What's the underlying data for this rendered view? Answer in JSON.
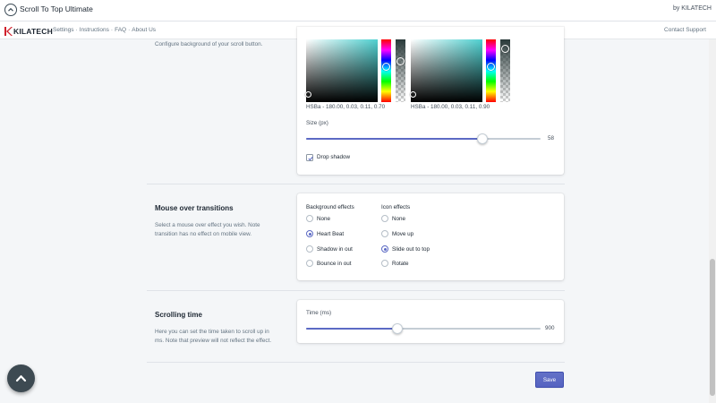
{
  "app": {
    "title": "Scroll To Top Ultimate",
    "byline": "by KILATECH"
  },
  "nav": {
    "brand": "KILATECH",
    "links": [
      "Settings",
      "Instructions",
      "FAQ",
      "About Us"
    ],
    "separator": "·",
    "contact": "Contact Support"
  },
  "background_section": {
    "description": "Configure background of your scroll button.",
    "picker1": {
      "label": "HSBa - 180.00, 0.03, 0.11, 0.70",
      "alpha": 0.7
    },
    "picker2": {
      "label": "HSBa - 180.00, 0.03, 0.11, 0.90",
      "alpha": 0.9
    },
    "size": {
      "label": "Size (px)",
      "value": "58",
      "fraction": 0.75
    },
    "drop_shadow": {
      "label": "Drop shadow",
      "checked": true
    }
  },
  "mouse_over": {
    "title": "Mouse over transitions",
    "description": "Select a mouse over effect you wish. Note transition has no effect on mobile view.",
    "background_effects": {
      "title": "Background effects",
      "options": [
        "None",
        "Heart Beat",
        "Shadow in out",
        "Bounce in out"
      ],
      "selected": 1
    },
    "icon_effects": {
      "title": "Icon effects",
      "options": [
        "None",
        "Move up",
        "Slide out to top",
        "Rotate"
      ],
      "selected": 2
    }
  },
  "scrolling_time": {
    "title": "Scrolling time",
    "description": "Here you can set the time taken to scroll up in ms. Note that preview will not reflect the effect.",
    "label": "Time (ms)",
    "value": "900",
    "fraction": 0.39
  },
  "actions": {
    "save_label": "Save"
  },
  "icons": {
    "app_logo": "chevron-up-circle-icon",
    "brand_mark": "kilatech-k-icon",
    "checkbox_check": "check-icon",
    "scroll_top": "chevron-up-icon"
  },
  "colors": {
    "accent": "#5c6ac4",
    "fab": "#3d4a52",
    "page_bg": "#f4f6f8"
  }
}
